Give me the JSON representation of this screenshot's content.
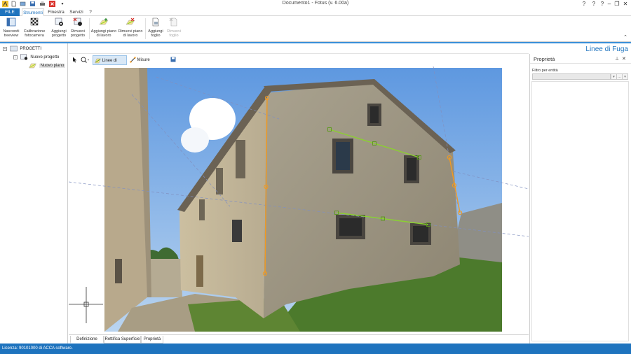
{
  "window": {
    "title": "Documento1 - Fotus (v. 6.00a)",
    "controls": [
      "?",
      "?",
      "?",
      "–",
      "❐",
      "✕"
    ]
  },
  "menu": {
    "file": "FILE",
    "tabs": [
      "Strumenti",
      "Finestra",
      "Servizi",
      "?"
    ],
    "active_tab": "Strumenti"
  },
  "ribbon": {
    "buttons": [
      {
        "label1": "Nascondi",
        "label2": "treeview",
        "icon": "treeview-icon",
        "enabled": true
      },
      {
        "label1": "Calibrazione",
        "label2": "fotocamera",
        "icon": "checkerboard-icon",
        "enabled": true
      },
      {
        "label1": "Aggiungi",
        "label2": "progetto",
        "icon": "add-project-icon",
        "enabled": true
      },
      {
        "label1": "Rimuovi",
        "label2": "progetto",
        "icon": "remove-project-icon",
        "enabled": true
      },
      {
        "label1": "Aggiungi piano",
        "label2": "di lavoro",
        "icon": "add-plane-icon",
        "enabled": true
      },
      {
        "label1": "Rimuovi piano",
        "label2": "di lavoro",
        "icon": "remove-plane-icon",
        "enabled": true
      },
      {
        "label1": "Aggiungi",
        "label2": "foglio",
        "icon": "add-sheet-icon",
        "enabled": true
      },
      {
        "label1": "Rimuovi",
        "label2": "foglio",
        "icon": "remove-sheet-icon",
        "enabled": false
      }
    ]
  },
  "tree": {
    "root": "PROGETTI",
    "project": "Nuovo progetto",
    "plane": "Nuovo piano"
  },
  "center": {
    "heading": "Linee di Fuga",
    "toolbar": {
      "vanishing_lines": "Linee di Fuga",
      "sample_measure": "Misure campione"
    },
    "bottom_tabs": [
      "Definizione piano",
      "Rettifica Superficie",
      "Proprietà"
    ],
    "active_bottom_tab": "Definizione piano"
  },
  "properties": {
    "title": "Proprietà",
    "filter_label": "Filtro per entità",
    "filter_value": ""
  },
  "status": {
    "text": "Licenza: 90101000 di ACCA software."
  },
  "colors": {
    "accent": "#1e73be",
    "orange_lines": "#f39a1e",
    "green_lines": "#8bd12f"
  }
}
